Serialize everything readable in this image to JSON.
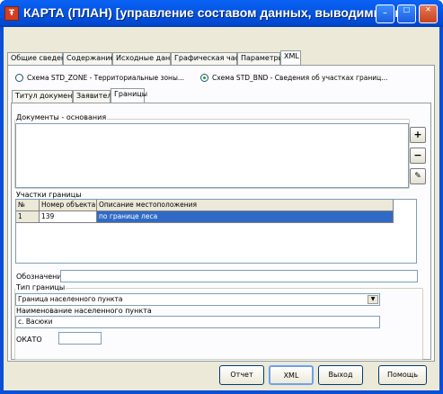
{
  "window": {
    "title": "КАРТА (ПЛАН) [управление составом данных, выводимых в ..."
  },
  "main_tabs": [
    "Общие сведения",
    "Содержание",
    "Исходные данные",
    "Графическая часть",
    "Параметры",
    "XML"
  ],
  "schemes": {
    "zone": "Схема STD_ZONE - Территориальные зоны...",
    "bnd": "Схема STD_BND - Сведения об участках границ..."
  },
  "sub_tabs": [
    "Титул документа",
    "Заявитель",
    "Границы"
  ],
  "docs": {
    "label": "Документы - основания"
  },
  "parts": {
    "label": "Участки границы",
    "columns": [
      "№",
      "Номер объекта",
      "Описание местоположения"
    ],
    "rows": [
      [
        "1",
        "139",
        "по границе леса"
      ]
    ]
  },
  "designation": {
    "label": "Обозначение",
    "value": ""
  },
  "boundary_type": {
    "label": "Тип границы",
    "value": "Граница населенного пункта"
  },
  "settlement": {
    "label": "Наименование населенного пункта",
    "value": "с. Васюки"
  },
  "okato": {
    "label": "ОКАТО",
    "value": ""
  },
  "buttons": {
    "report": "Отчет",
    "xml": "XML",
    "exit": "Выход",
    "help": "Помощь"
  }
}
